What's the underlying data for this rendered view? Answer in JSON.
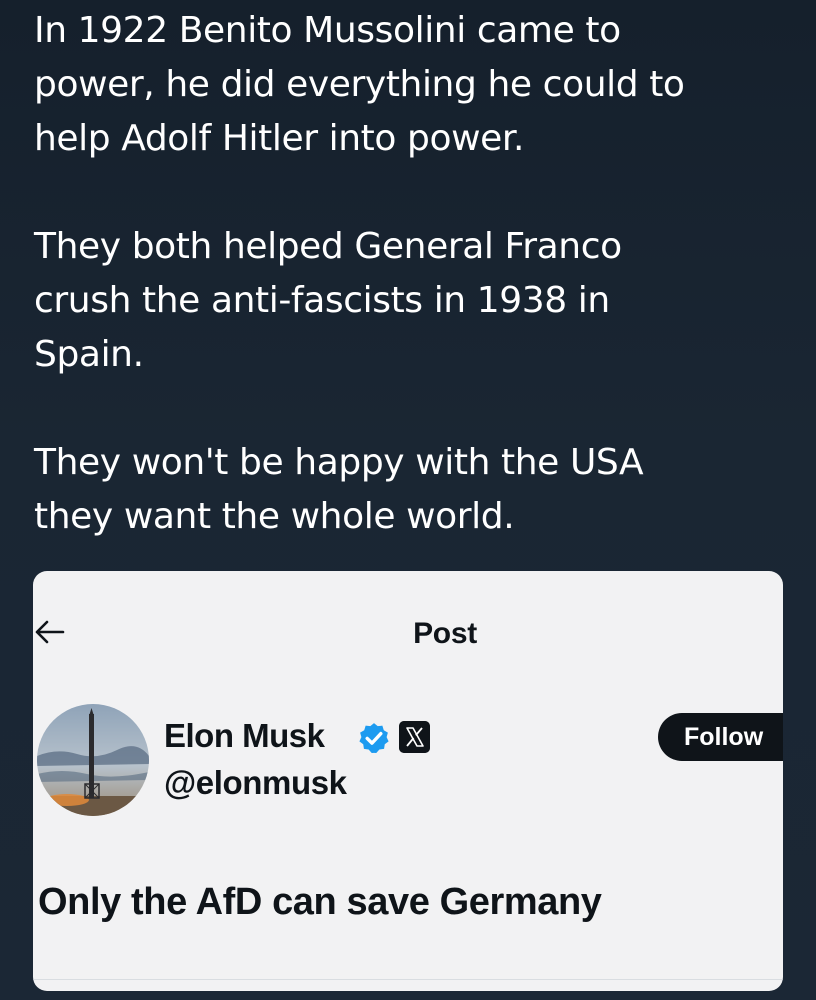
{
  "post": {
    "paragraphs": [
      {
        "lines": [
          "In 1922 Benito Mussolini came to",
          "power, he did everything he could to",
          "help Adolf Hitler into power."
        ]
      },
      {
        "lines": [
          "They both helped General Franco",
          "crush the anti-fascists in 1938 in",
          "Spain."
        ]
      },
      {
        "lines": [
          "They won't be happy with the USA",
          "they want the whole world."
        ]
      }
    ]
  },
  "embedded_screenshot": {
    "header": {
      "back_icon": "arrow-left-icon",
      "title": "Post"
    },
    "author": {
      "avatar_icon": "rocket-launch-avatar",
      "name": "Elon Musk",
      "verified_icon": "verified-badge-icon",
      "affiliation_icon": "x-logo-icon",
      "handle": "@elonmusk"
    },
    "follow_button_label": "Follow",
    "tweet_text": "Only the AfD can save Germany",
    "colors": {
      "background": "#15202c",
      "card": "#f2f2f3",
      "text_dark": "#0f1419",
      "verified_blue": "#1d9bf0"
    }
  }
}
